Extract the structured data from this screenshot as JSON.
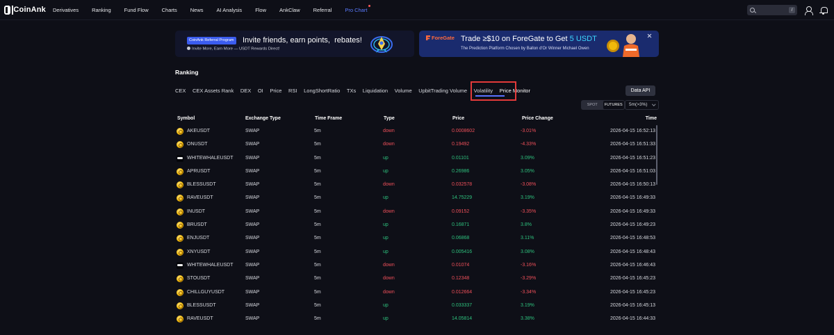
{
  "nav": {
    "logo": "CoinAnk",
    "links": [
      "Derivatives",
      "Ranking",
      "Fund Flow",
      "Charts",
      "News",
      "AI Analysis",
      "Flow",
      "AnkClaw",
      "Referral"
    ],
    "pro": "Pro Chart",
    "search_key": "/"
  },
  "banners": {
    "left": {
      "badge": "CoinAnk Referral Program",
      "title": "Invite friends, earn points,  rebates!",
      "subtitle": "Invite More, Earn More — USDT Rewards Direct!"
    },
    "right": {
      "logo": "ForeGate",
      "title": "Trade ≥$10 on ForeGate to Get ",
      "title_amount": "5 USDT",
      "subtitle": "The Prediction Platform Chosen by Ballon d'Or Winner Michael Owen"
    }
  },
  "ranking": {
    "title": "Ranking",
    "tabs": [
      "CEX",
      "CEX Assets Rank",
      "DEX",
      "OI",
      "Price",
      "RSI",
      "LongShortRatio",
      "TXs",
      "Liquidation",
      "Volume",
      "UpbitTrading Volume",
      "Volatility",
      "Price Monitor"
    ],
    "active_tab": "Price Monitor",
    "data_api": "Data API",
    "market_toggle": [
      "SPOT",
      "FUTURES"
    ],
    "timeframe": "5m(>3%)"
  },
  "table": {
    "headers": [
      "Symbol",
      "Exchange Type",
      "Time Frame",
      "Type",
      "Price",
      "Price Change",
      "Time"
    ],
    "rows": [
      {
        "symbol": "AKEUSDT",
        "exchange": "SWAP",
        "tf": "5m",
        "type": "down",
        "price": "0.0008602",
        "change": "-3.01%",
        "time": "2026-04-15 16:52:13",
        "icon": "coin"
      },
      {
        "symbol": "ONUSDT",
        "exchange": "SWAP",
        "tf": "5m",
        "type": "down",
        "price": "0.19492",
        "change": "-4.33%",
        "time": "2026-04-15 16:51:33",
        "icon": "coin"
      },
      {
        "symbol": "WHITEWHALEUSDT",
        "exchange": "SWAP",
        "tf": "5m",
        "type": "up",
        "price": "0.01101",
        "change": "3.09%",
        "time": "2026-04-15 16:51:23",
        "icon": "whale"
      },
      {
        "symbol": "APRUSDT",
        "exchange": "SWAP",
        "tf": "5m",
        "type": "up",
        "price": "0.26986",
        "change": "3.05%",
        "time": "2026-04-15 16:51:03",
        "icon": "coin"
      },
      {
        "symbol": "BLESSUSDT",
        "exchange": "SWAP",
        "tf": "5m",
        "type": "down",
        "price": "0.032578",
        "change": "-3.08%",
        "time": "2026-04-15 16:50:13",
        "icon": "coin"
      },
      {
        "symbol": "RAVEUSDT",
        "exchange": "SWAP",
        "tf": "5m",
        "type": "up",
        "price": "14.75229",
        "change": "3.19%",
        "time": "2026-04-15 16:49:33",
        "icon": "coin"
      },
      {
        "symbol": "INUSDT",
        "exchange": "SWAP",
        "tf": "5m",
        "type": "down",
        "price": "0.09152",
        "change": "-3.35%",
        "time": "2026-04-15 16:49:33",
        "icon": "coin"
      },
      {
        "symbol": "BRUSDT",
        "exchange": "SWAP",
        "tf": "5m",
        "type": "up",
        "price": "0.16871",
        "change": "3.8%",
        "time": "2026-04-15 16:49:23",
        "icon": "coin"
      },
      {
        "symbol": "ENJUSDT",
        "exchange": "SWAP",
        "tf": "5m",
        "type": "up",
        "price": "0.06868",
        "change": "3.11%",
        "time": "2026-04-15 16:48:53",
        "icon": "coin"
      },
      {
        "symbol": "XNYUSDT",
        "exchange": "SWAP",
        "tf": "5m",
        "type": "up",
        "price": "0.005416",
        "change": "3.08%",
        "time": "2026-04-15 16:48:43",
        "icon": "coin"
      },
      {
        "symbol": "WHITEWHALEUSDT",
        "exchange": "SWAP",
        "tf": "5m",
        "type": "down",
        "price": "0.01074",
        "change": "-3.16%",
        "time": "2026-04-15 16:46:43",
        "icon": "whale"
      },
      {
        "symbol": "STOUSDT",
        "exchange": "SWAP",
        "tf": "5m",
        "type": "down",
        "price": "0.12348",
        "change": "-3.29%",
        "time": "2026-04-15 16:45:23",
        "icon": "coin"
      },
      {
        "symbol": "CHILLGUYUSDT",
        "exchange": "SWAP",
        "tf": "5m",
        "type": "down",
        "price": "0.012664",
        "change": "-3.34%",
        "time": "2026-04-15 16:45:23",
        "icon": "coin"
      },
      {
        "symbol": "BLESSUSDT",
        "exchange": "SWAP",
        "tf": "5m",
        "type": "up",
        "price": "0.033337",
        "change": "3.19%",
        "time": "2026-04-15 16:45:13",
        "icon": "coin"
      },
      {
        "symbol": "RAVEUSDT",
        "exchange": "SWAP",
        "tf": "5m",
        "type": "up",
        "price": "14.05814",
        "change": "3.38%",
        "time": "2026-04-15 16:44:33",
        "icon": "coin"
      }
    ]
  },
  "colors": {
    "background": "#0e0f17",
    "accent": "#5a72ff",
    "up": "#2ec27e",
    "down": "#f0505a",
    "highlight": "#e23a3a"
  }
}
